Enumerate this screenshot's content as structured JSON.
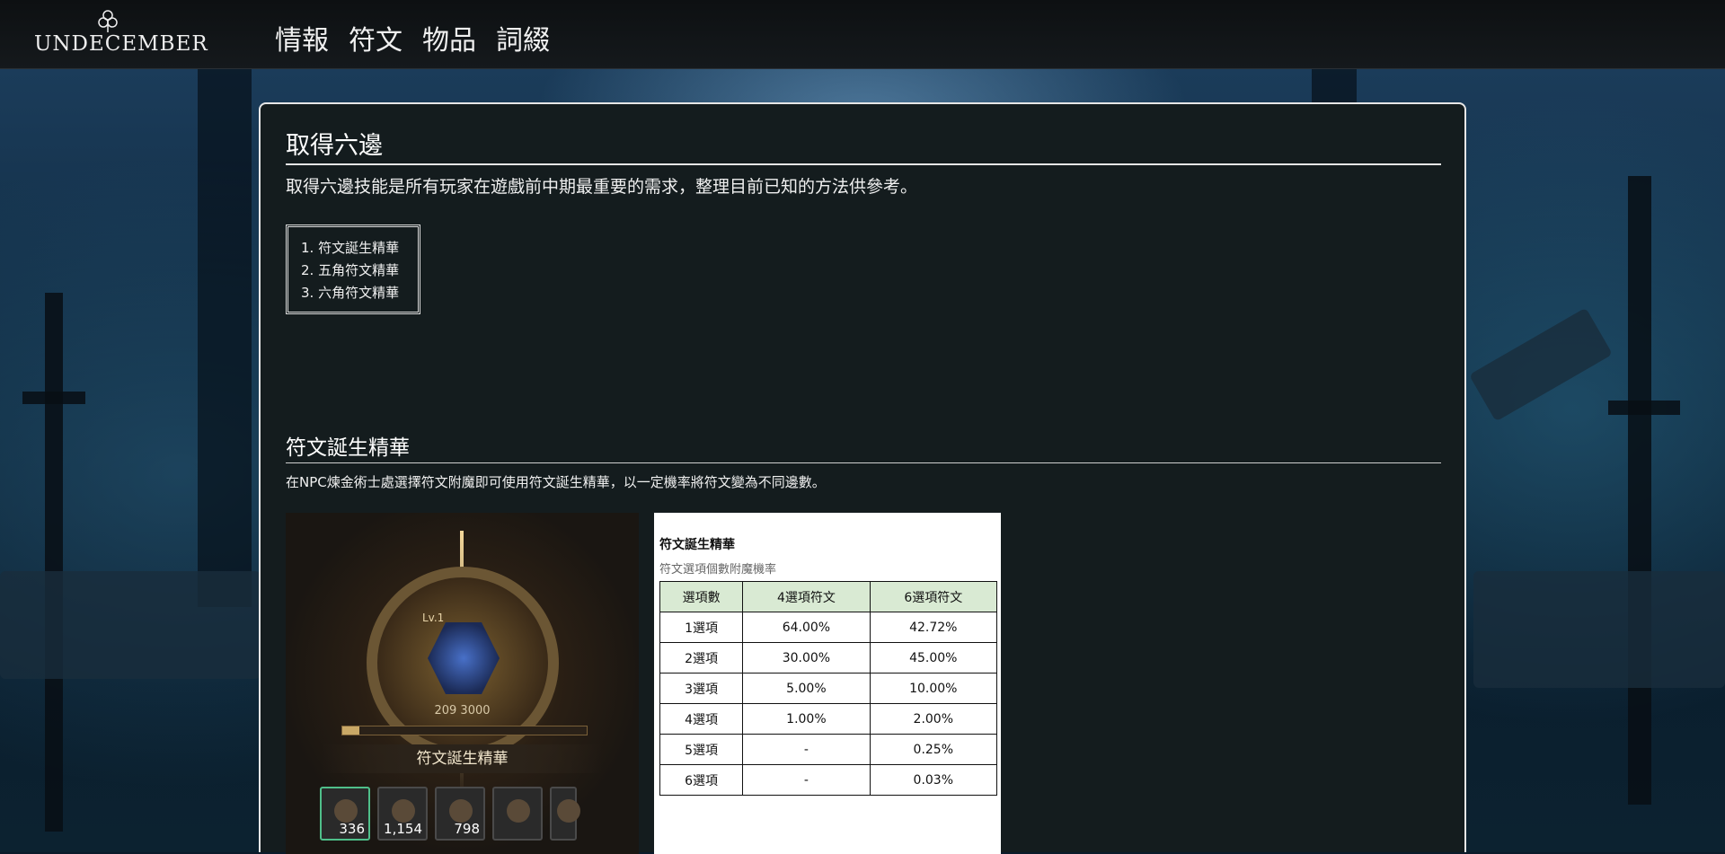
{
  "site": {
    "logo_text": "UNDECEMBER",
    "nav": [
      "情報",
      "符文",
      "物品",
      "詞綴"
    ]
  },
  "article": {
    "title": "取得六邊",
    "intro": "取得六邊技能是所有玩家在遊戲前中期最重要的需求，整理目前已知的方法供參考。",
    "toc": [
      "1. 符文誕生精華",
      "2. 五角符文精華",
      "3. 六角符文精華"
    ]
  },
  "section1": {
    "heading": "符文誕生精華",
    "description": "在NPC煉金術士處選擇符文附魔即可使用符文誕生精華，以一定機率將符文變為不同邊數。",
    "screenshot": {
      "level": "Lv.1",
      "progress_text": "209 3000",
      "progress_value": 209,
      "progress_max": 3000,
      "item_name": "符文誕生精華",
      "slots": [
        {
          "qty": "336",
          "icon": "essence-icon"
        },
        {
          "qty": "1,154",
          "icon": "essence-icon"
        },
        {
          "qty": "798",
          "icon": "essence-icon"
        },
        {
          "qty": "",
          "icon": "essence-icon"
        },
        {
          "qty": "",
          "icon": "essence-icon"
        }
      ]
    },
    "table": {
      "title": "符文誕生精華",
      "subtitle": "符文選項個數附魔機率",
      "headers": [
        "選項數",
        "4選項符文",
        "6選項符文"
      ],
      "rows": [
        [
          "1選項",
          "64.00%",
          "42.72%"
        ],
        [
          "2選項",
          "30.00%",
          "45.00%"
        ],
        [
          "3選項",
          "5.00%",
          "10.00%"
        ],
        [
          "4選項",
          "1.00%",
          "2.00%"
        ],
        [
          "5選項",
          "-",
          "0.25%"
        ],
        [
          "6選項",
          "-",
          "0.03%"
        ]
      ]
    }
  }
}
